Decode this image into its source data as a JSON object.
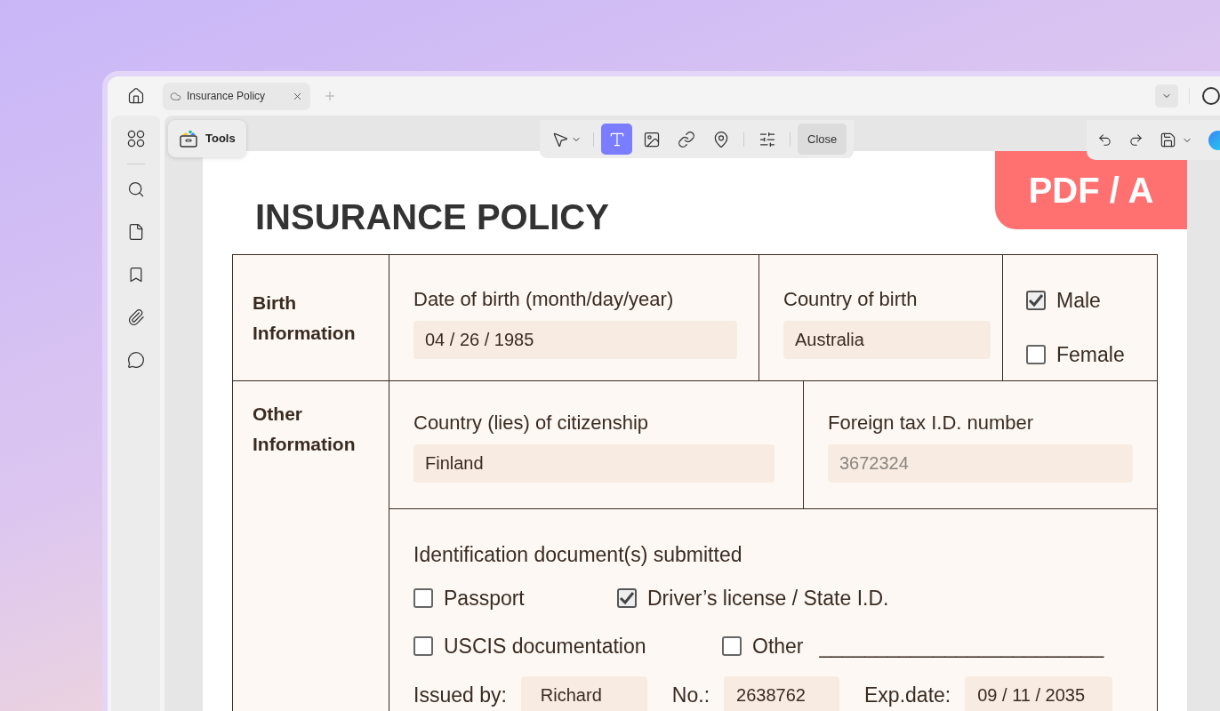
{
  "tabs": [
    {
      "title": "Insurance Policy",
      "selected": true
    }
  ],
  "tools_button": "Tools",
  "toolbar": {
    "tools": [
      {
        "kind": "select",
        "selected": false
      },
      {
        "kind": "text",
        "selected": true
      },
      {
        "kind": "image",
        "selected": false
      },
      {
        "kind": "link",
        "selected": false
      },
      {
        "kind": "location",
        "selected": false
      },
      {
        "kind": "adjust",
        "selected": false
      }
    ],
    "close": "Close"
  },
  "document": {
    "title": "INSURANCE POLICY",
    "badge": "PDF / A",
    "birth": {
      "label": "Birth Information",
      "fields": [
        {
          "label": "Date of birth (month/day/year)",
          "value": "04 / 26 / 1985"
        },
        {
          "label": "Country of birth",
          "value": "Australia"
        }
      ],
      "options": [
        {
          "label": "Male",
          "checked": true
        },
        {
          "label": "Female",
          "checked": false
        }
      ]
    },
    "other": {
      "label": "Other Information",
      "fields": [
        {
          "label": "Country (lies) of citizenship",
          "value": "Finland"
        },
        {
          "label": "Foreign tax I.D. number",
          "placeholder": "3672324"
        }
      ],
      "documents": {
        "heading": "Identification document(s) submitted",
        "options": [
          {
            "label": "Passport",
            "checked": false
          },
          {
            "label": "Driver’s license / State I.D.",
            "checked": true
          },
          {
            "label": "USCIS documentation",
            "checked": false
          },
          {
            "label": "Other",
            "checked": false,
            "line": "_________________________"
          }
        ],
        "issued": [
          {
            "label": "Issued by:",
            "value": "Richard"
          },
          {
            "label": "No.:",
            "value": "2638762"
          },
          {
            "label": "Exp.date:",
            "value": "09 / 11 / 2035"
          }
        ]
      }
    }
  }
}
